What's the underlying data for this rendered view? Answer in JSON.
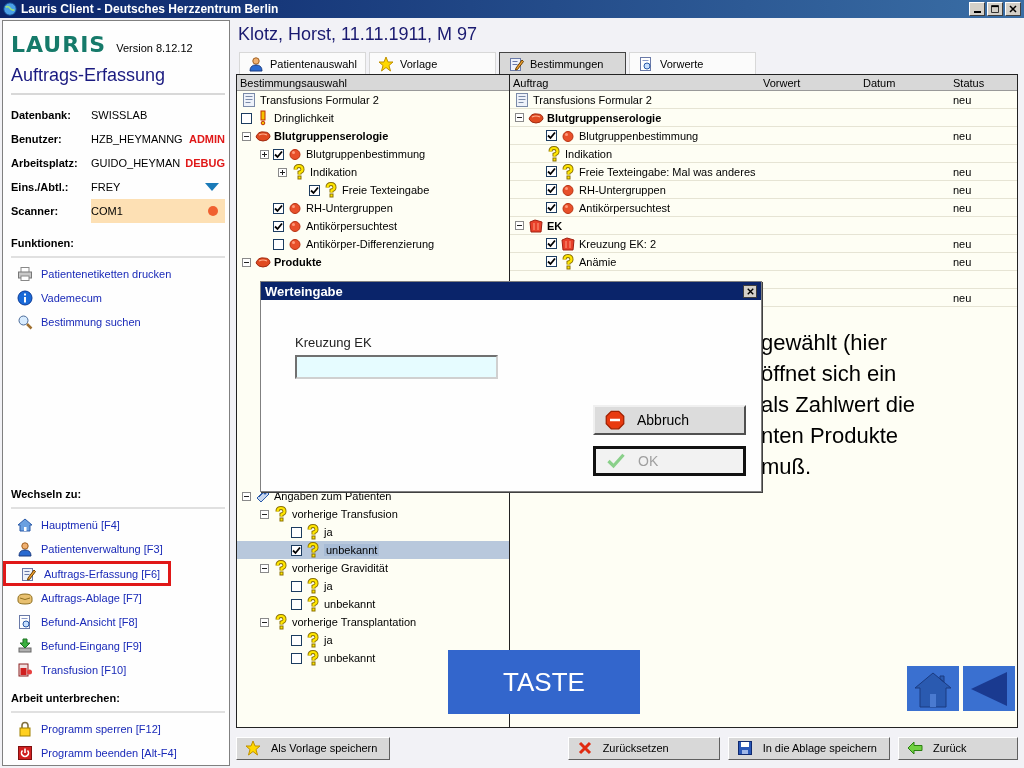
{
  "window": {
    "title": "Lauris Client - Deutsches Herzzentrum Berlin"
  },
  "sidebar": {
    "logo": "LAURIS",
    "version": "Version 8.12.12",
    "module": "Auftrags-Erfassung",
    "info": [
      {
        "label": "Datenbank:",
        "value": "SWISSLAB",
        "kind": "plain"
      },
      {
        "label": "Benutzer:",
        "value": "HZB_HEYMANNG",
        "badge": "ADMIN",
        "kind": "plain"
      },
      {
        "label": "Arbeitsplatz:",
        "value": "GUIDO_HEYMAN",
        "badge": "DEBUG",
        "kind": "plain"
      },
      {
        "label": "Eins./Abtl.:",
        "value": "FREY",
        "kind": "dropdown"
      },
      {
        "label": "Scanner:",
        "value": "COM1",
        "kind": "scanner"
      }
    ],
    "functions": {
      "heading": "Funktionen:",
      "items": [
        {
          "label": "Patientenetiketten drucken",
          "kind": "printer"
        },
        {
          "label": "Vademecum",
          "kind": "info"
        },
        {
          "label": "Bestimmung suchen",
          "kind": "search"
        }
      ]
    },
    "switch": {
      "heading": "Wechseln zu:",
      "items": [
        {
          "label": "Hauptmenü [F4]",
          "kind": "home",
          "selected": false
        },
        {
          "label": "Patientenverwaltung [F3]",
          "kind": "person",
          "selected": false
        },
        {
          "label": "Auftrags-Erfassung [F6]",
          "kind": "edit",
          "selected": true
        },
        {
          "label": "Auftrags-Ablage [F7]",
          "kind": "archive",
          "selected": false
        },
        {
          "label": "Befund-Ansicht [F8]",
          "kind": "report",
          "selected": false
        },
        {
          "label": "Befund-Eingang [F9]",
          "kind": "download",
          "selected": false
        },
        {
          "label": "Transfusion [F10]",
          "kind": "transfusion",
          "selected": false
        }
      ]
    },
    "pause": {
      "heading": "Arbeit unterbrechen:",
      "items": [
        {
          "label": "Programm sperren [F12]",
          "kind": "lock"
        },
        {
          "label": "Programm beenden [Alt-F4]",
          "kind": "power"
        }
      ]
    }
  },
  "patient": "Klotz, Horst, 11.11.1911, M 97",
  "tabs": [
    {
      "label": "Patientenauswahl",
      "kind": "person",
      "selected": false
    },
    {
      "label": "Vorlage",
      "kind": "star",
      "selected": false
    },
    {
      "label": "Bestimmungen",
      "kind": "edit",
      "selected": true
    },
    {
      "label": "Vorwerte",
      "kind": "report",
      "selected": false
    }
  ],
  "left_pane": {
    "header": "Bestimmungsauswahl",
    "tree_top": [
      {
        "label": "Transfusions Formular 2",
        "kind": "form",
        "selected": false
      },
      {
        "label": "Dringlichkeit",
        "kind": "urgent",
        "checked": false,
        "selected": false
      },
      {
        "label": "Blutgruppenserologie",
        "kind": "group",
        "expanded": true,
        "selected": false,
        "children": [
          {
            "label": "Blutgruppenbestimmung",
            "kind": "test",
            "expanded": false,
            "checked": true,
            "selected": false,
            "children": [
              {
                "label": "Indikation",
                "kind": "question",
                "expanded": false,
                "selected": false,
                "children": [
                  {
                    "label": "Freie Texteingabe",
                    "kind": "question",
                    "checked": true,
                    "selected": false
                  }
                ]
              }
            ]
          },
          {
            "label": "RH-Untergruppen",
            "kind": "test",
            "checked": true,
            "selected": false
          },
          {
            "label": "Antikörpersuchtest",
            "kind": "test",
            "checked": true,
            "selected": false
          },
          {
            "label": "Antikörper-Differenzierung",
            "kind": "test",
            "checked": false,
            "selected": false
          }
        ]
      },
      {
        "label": "Produkte",
        "kind": "group",
        "expanded": true,
        "selected": false
      }
    ],
    "tree_bottom": [
      {
        "label": "Angaben zum Patienten",
        "kind": "patient",
        "expanded": true,
        "selected": false,
        "children": [
          {
            "label": "vorherige Transfusion",
            "kind": "question",
            "expanded": true,
            "selected": false,
            "children": [
              {
                "label": "ja",
                "kind": "question",
                "checked": false,
                "selected": false
              },
              {
                "label": "unbekannt",
                "kind": "question",
                "checked": true,
                "selected": true
              }
            ]
          },
          {
            "label": "vorherige Gravidität",
            "kind": "question",
            "expanded": true,
            "selected": false,
            "children": [
              {
                "label": "ja",
                "kind": "question",
                "checked": false,
                "selected": false
              },
              {
                "label": "unbekannt",
                "kind": "question",
                "checked": false,
                "selected": false
              }
            ]
          },
          {
            "label": "vorherige Transplantation",
            "kind": "question",
            "expanded": true,
            "selected": false,
            "children": [
              {
                "label": "ja",
                "kind": "question",
                "checked": false,
                "selected": false
              },
              {
                "label": "unbekannt",
                "kind": "question",
                "checked": false,
                "selected": false
              }
            ]
          }
        ]
      }
    ]
  },
  "right_pane": {
    "columns": [
      "Auftrag",
      "Vorwert",
      "Datum",
      "Status"
    ],
    "rows": [
      {
        "label": "Transfusions Formular 2",
        "kind": "form",
        "status": "neu"
      },
      {
        "label": "Blutgruppenserologie",
        "kind": "group",
        "expanded": true,
        "children": [
          {
            "label": "Blutgruppenbestimmung",
            "kind": "test",
            "checked": true,
            "status": "neu"
          },
          {
            "label": "Indikation",
            "kind": "question"
          },
          {
            "label": "Freie Texteingabe: Mal was anderes",
            "kind": "question",
            "checked": true,
            "status": "neu"
          },
          {
            "label": "RH-Untergruppen",
            "kind": "test",
            "checked": true,
            "status": "neu"
          },
          {
            "label": "Antikörpersuchtest",
            "kind": "test",
            "checked": true,
            "status": "neu"
          }
        ]
      },
      {
        "label": "EK",
        "kind": "product",
        "expanded": true,
        "children": [
          {
            "label": "Kreuzung EK: 2",
            "kind": "product",
            "checked": true,
            "status": "neu"
          },
          {
            "label": "Anämie",
            "kind": "question",
            "checked": true,
            "status": "neu"
          }
        ]
      }
    ],
    "partial_row_status": "neu"
  },
  "overlay_text": [
    "gewählt (hier",
    "öffnet sich ein",
    "als Zahlwert die",
    "nten Produkte",
    "muß."
  ],
  "taste": "TASTE",
  "nav_buttons": [
    {
      "kind": "home"
    },
    {
      "kind": "back"
    }
  ],
  "dialog": {
    "title": "Werteingabe",
    "field_label": "Kreuzung EK",
    "buttons": [
      {
        "label": "Abbruch",
        "kind": "cancel",
        "disabled": false
      },
      {
        "label": "OK",
        "kind": "ok",
        "disabled": true
      }
    ]
  },
  "footer_buttons": [
    {
      "label": "Als Vorlage speichern",
      "kind": "star"
    },
    {
      "label": "Zurücksetzen",
      "kind": "cross"
    },
    {
      "label": "In die Ablage speichern",
      "kind": "disk"
    },
    {
      "label": "Zurück",
      "kind": "arrowleft"
    }
  ]
}
